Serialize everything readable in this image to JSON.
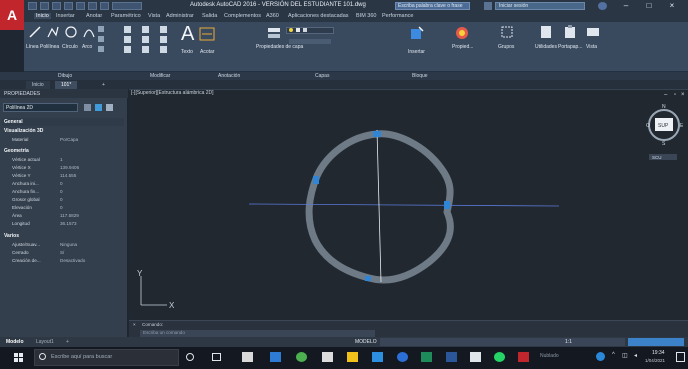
{
  "app": {
    "logo_letter": "A",
    "window_title": "Autodesk AutoCAD 2016 - VERSIÓN DEL ESTUDIANTE  101.dwg",
    "search_placeholder": "Escriba palabra clave o frase",
    "login_text": "Iniciar sesión",
    "window_controls": [
      "–",
      "□",
      "×"
    ]
  },
  "menu": {
    "items": [
      "Inicio",
      "Insertar",
      "Anotar",
      "Paramétrico",
      "Vista",
      "Administrar",
      "Salida",
      "Complementos",
      "A360",
      "Aplicaciones destacadas",
      "BIM 360",
      "Performance"
    ],
    "active_index": 0
  },
  "ribbon": {
    "draw_tools": [
      "Línea",
      "Polilínea",
      "Círculo",
      "Arco"
    ],
    "text_label": "Texto",
    "dimension_label": "Acotar",
    "properties_label": "Propiedades de capa",
    "insert_label": "Insertar",
    "properties_btn": "Propied...",
    "groups_label": "Grupos",
    "utilities_label": "Utilidades",
    "clipboard_label": "Portapap...",
    "view_label": "Vista"
  },
  "panels": [
    "Dibujo",
    "Modificar",
    "Anotación",
    "Capas",
    "Bloque",
    "",
    "",
    "",
    ""
  ],
  "file_tabs": [
    "Inicio",
    "101*",
    "+"
  ],
  "properties": {
    "title": "PROPIEDADES",
    "object_type": "Polilínea 2D",
    "sections": [
      {
        "name": "General",
        "rows": []
      },
      {
        "name": "Visualización 3D",
        "rows": [
          {
            "k": "Material",
            "v": "PorCapa"
          }
        ]
      },
      {
        "name": "Geometría",
        "rows": [
          {
            "k": "Vértice actual",
            "v": "1"
          },
          {
            "k": "Vértice X",
            "v": "139.9406"
          },
          {
            "k": "Vértice Y",
            "v": "114.555"
          },
          {
            "k": "Anchura ini...",
            "v": "0"
          },
          {
            "k": "Anchura fin...",
            "v": "0"
          },
          {
            "k": "Grosor global",
            "v": "0"
          },
          {
            "k": "Elevación",
            "v": "0"
          },
          {
            "k": "Área",
            "v": "117.5829"
          },
          {
            "k": "Longitud",
            "v": "36.1573"
          }
        ]
      },
      {
        "name": "Varios",
        "rows": [
          {
            "k": "Ajuste/Suav...",
            "v": "Ninguna"
          },
          {
            "k": "Cerrado",
            "v": "Sí"
          },
          {
            "k": "Creación de...",
            "v": "Desactivado"
          }
        ]
      }
    ]
  },
  "viewport": {
    "label": "[-][Superior][Estructura alámbrica 2D]",
    "viewcube_top": "SUP",
    "viewcube_dirs": {
      "n": "N",
      "s": "S",
      "e": "E",
      "w": "O"
    },
    "wcs_label": "SCU",
    "axis_y": "Y",
    "axis_x": "X",
    "polyline_color": "#6e7a86",
    "grip_color": "#2f86d6"
  },
  "command": {
    "history": "Comando:",
    "placeholder": "Escriba un comando"
  },
  "layout_tabs": [
    "Modelo",
    "Layout1",
    "+"
  ],
  "status": {
    "mode": "MODELO",
    "scale": "1:1"
  },
  "taskbar": {
    "search_placeholder": "Escribe aquí para buscar",
    "time": "19:34",
    "date": "1/04/2021",
    "weather": "Nublado"
  }
}
